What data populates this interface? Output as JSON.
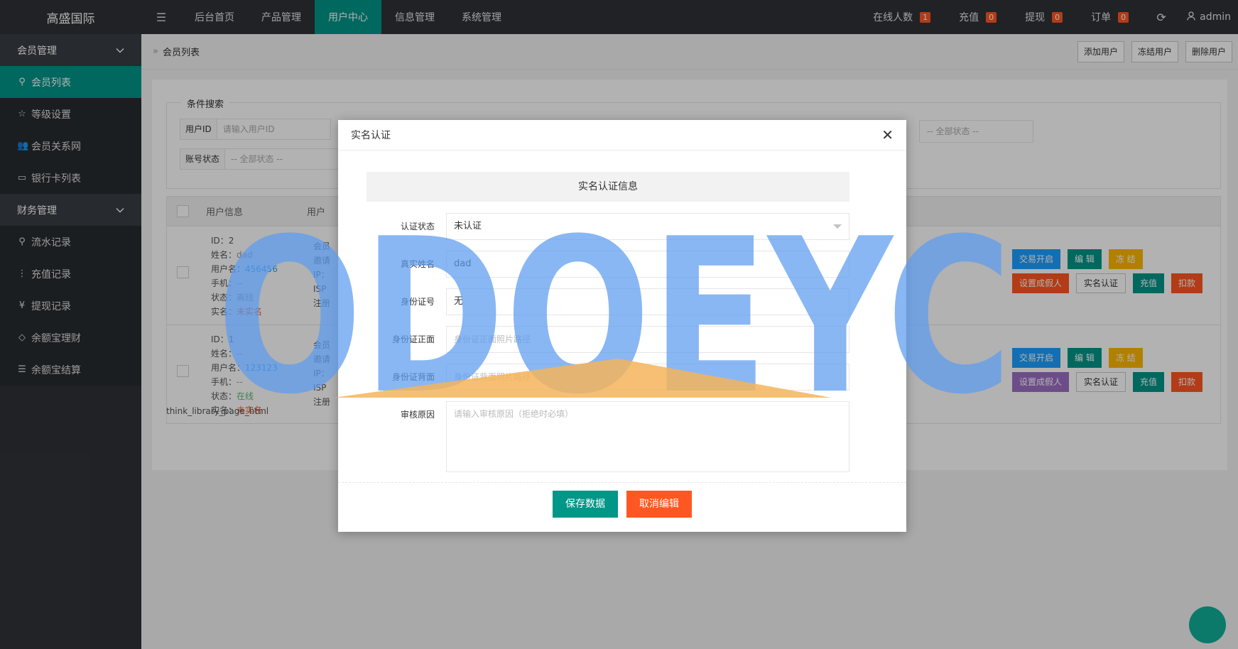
{
  "topbar": {
    "logo": "高盛国际",
    "menu_toggle_icon": "menu-icon",
    "nav": [
      "后台首页",
      "产品管理",
      "用户中心",
      "信息管理",
      "系统管理"
    ],
    "active_nav_index": 2,
    "stats": [
      {
        "label": "在线人数",
        "count": "1"
      },
      {
        "label": "充值",
        "count": "0"
      },
      {
        "label": "提现",
        "count": "0"
      },
      {
        "label": "订单",
        "count": "0"
      }
    ],
    "refresh_icon": "refresh-icon",
    "user": "admin"
  },
  "sidebar": {
    "groups": [
      {
        "label": "会员管理",
        "items": [
          {
            "label": "会员列表",
            "icon": "user-icon",
            "active": true
          },
          {
            "label": "等级设置",
            "icon": "star-icon"
          },
          {
            "label": "会员关系网",
            "icon": "users-icon"
          },
          {
            "label": "银行卡列表",
            "icon": "card-icon"
          }
        ]
      },
      {
        "label": "财务管理",
        "items": [
          {
            "label": "流水记录",
            "icon": "user-icon"
          },
          {
            "label": "充值记录",
            "icon": "more-icon"
          },
          {
            "label": "提现记录",
            "icon": "yen-icon"
          },
          {
            "label": "余额宝理财",
            "icon": "diamond-icon"
          },
          {
            "label": "余额宝结算",
            "icon": "server-icon"
          }
        ]
      }
    ]
  },
  "breadcrumb": {
    "title": "会员列表"
  },
  "actions": {
    "add": "添加用户",
    "freeze": "冻结用户",
    "delete": "删除用户"
  },
  "search": {
    "legend": "条件搜索",
    "user_id_label": "用户ID",
    "user_id_placeholder": "请输入用户ID",
    "account_status_label": "账号状态",
    "account_status_value": "-- 全部状态 --",
    "right_status_value": "-- 全部状态 --"
  },
  "table": {
    "headers": [
      "用户信息",
      "用户"
    ],
    "rows": [
      {
        "id": "2",
        "name": "dad",
        "username": "456456",
        "phone": "--",
        "status": "离线",
        "realname": "未实名",
        "status_online": false
      },
      {
        "id": "1",
        "name": "--",
        "username": "123123",
        "phone": "--",
        "status": "在线",
        "realname": "未实名",
        "status_online": true
      }
    ],
    "field_labels": {
      "id": "ID：",
      "name": "姓名：",
      "username": "用户名：",
      "phone": "手机：",
      "status": "状态：",
      "realname": "实名："
    },
    "col2_labels": [
      "会员",
      "邀请",
      "IP：",
      "ISP",
      "注册"
    ],
    "row_buttons": {
      "trade": "交易开启",
      "edit": "编 辑",
      "freeze": "冻 结",
      "fake": "设置成假人",
      "verify": "实名认证",
      "recharge": "充值",
      "deduct": "扣款"
    }
  },
  "pager": "think_library_page_html",
  "modal": {
    "title": "实名认证",
    "section_title": "实名认证信息",
    "fields": {
      "status_label": "认证状态",
      "status_value": "未认证",
      "name_label": "真实姓名",
      "name_value": "dad",
      "idno_label": "身份证号",
      "idno_value": "无",
      "front_label": "身份证正面",
      "front_placeholder": "身份证正面照片路径",
      "back_label": "身份证背面",
      "back_placeholder": "身份证背面照片路径",
      "reason_label": "审核原因",
      "reason_placeholder": "请输入审核原因（拒绝时必填）"
    },
    "save": "保存数据",
    "cancel": "取消编辑",
    "close_icon": "close-icon"
  },
  "watermark": {
    "text": "ODOEYC",
    "color": "#5b9bee",
    "accent": "#f4b45a"
  },
  "colors": {
    "teal": "#009688",
    "orange": "#ff5722",
    "blue": "#1e9fff",
    "yellow": "#ffb800",
    "dark": "#2f3237"
  }
}
